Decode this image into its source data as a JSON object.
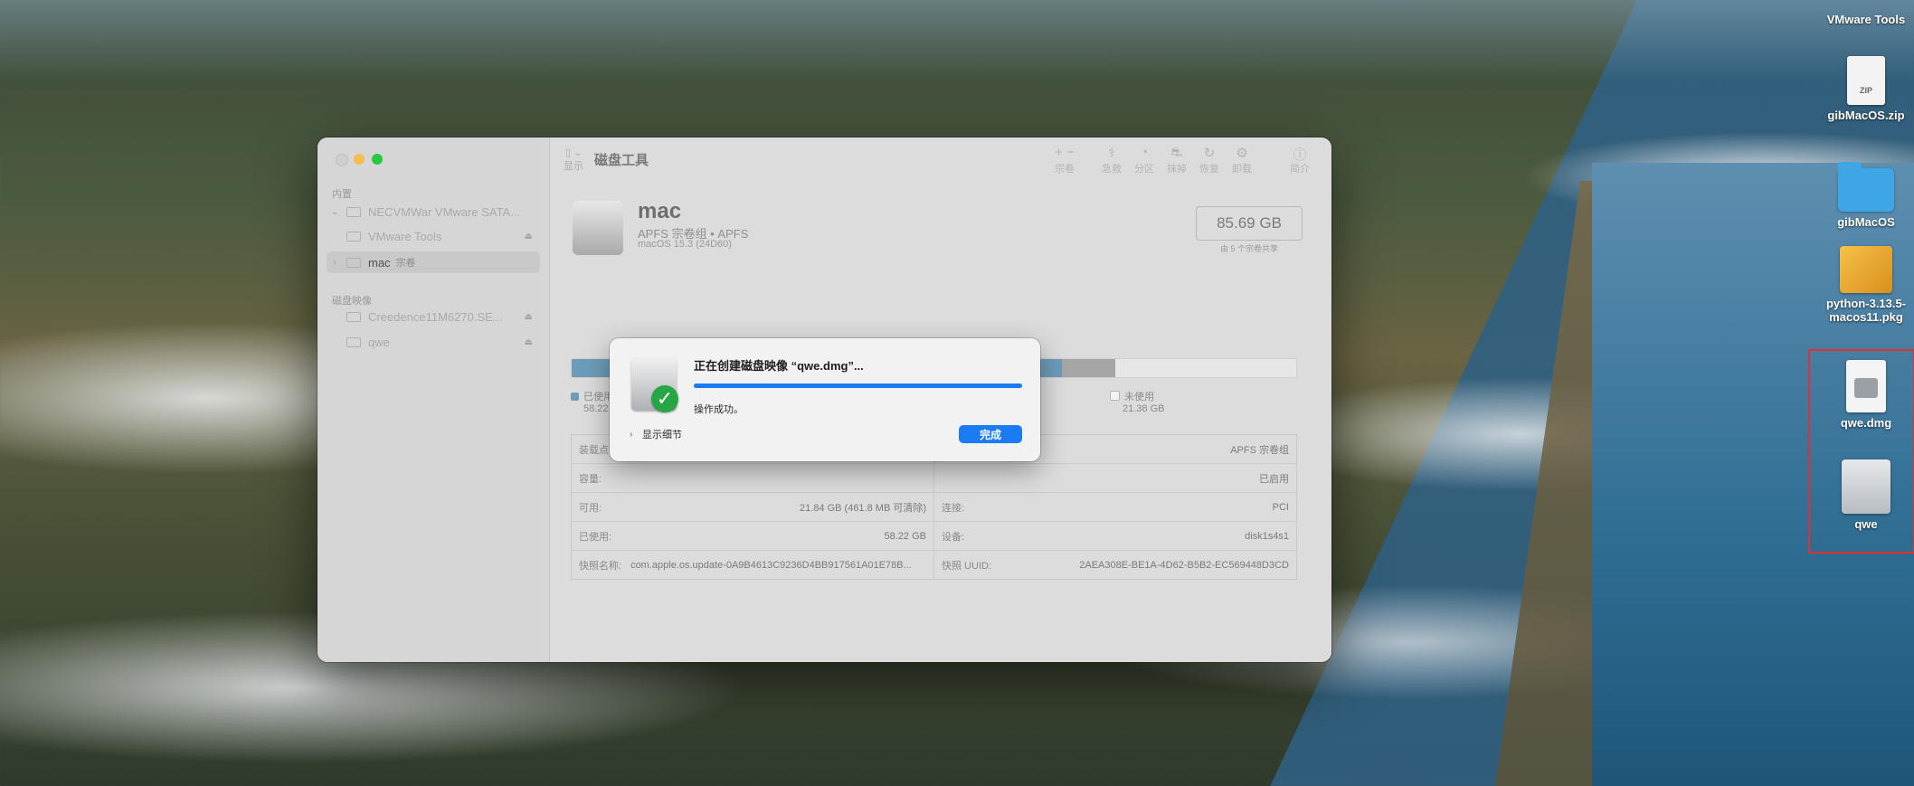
{
  "desktop": {
    "icons": [
      {
        "label": "VMware Tools"
      },
      {
        "label": "gibMacOS.zip",
        "badge": "ZIP"
      },
      {
        "label": "gibMacOS"
      },
      {
        "label": "python-3.13.5-macos11.pkg"
      },
      {
        "label": "qwe.dmg"
      },
      {
        "label": "qwe"
      }
    ]
  },
  "window": {
    "toolbar": {
      "title": "磁盘工具",
      "view_label": "显示",
      "buttons": [
        "宗卷",
        "急救",
        "分区",
        "抹掉",
        "恢复",
        "卸载",
        "简介"
      ],
      "add_remove": "+ −"
    },
    "sidebar": {
      "internal_header": "内置",
      "internal_items": [
        {
          "label": "NECVMWar VMware SATA..."
        },
        {
          "label": "VMware Tools"
        },
        {
          "label": "mac",
          "sub": "宗卷"
        }
      ],
      "images_header": "磁盘映像",
      "image_items": [
        {
          "label": "Creedence11M6270.SE..."
        },
        {
          "label": "qwe"
        }
      ]
    },
    "volume": {
      "name": "mac",
      "subtitle": "APFS 宗卷组 • APFS",
      "os": "macOS 15.3 (24D60)",
      "capacity": "85.69 GB",
      "capacity_note": "由 5 个宗卷共享"
    },
    "usage": {
      "used_fraction": 0.677,
      "other_fraction": 0.073,
      "used_label": "已使用",
      "used_value": "58.22 GB",
      "free_label": "未使用",
      "free_value": "21.38 GB"
    },
    "info": {
      "rows": [
        [
          {
            "label": "装载点:",
            "value": ""
          },
          {
            "label": "",
            "value": "APFS 宗卷组"
          }
        ],
        [
          {
            "label": "容量:",
            "value": ""
          },
          {
            "label": "",
            "value": "已启用"
          }
        ],
        [
          {
            "label": "可用:",
            "value": "21.84 GB (461.8 MB 可清除)"
          },
          {
            "label": "连接:",
            "value": "PCI"
          }
        ],
        [
          {
            "label": "已使用:",
            "value": "58.22 GB"
          },
          {
            "label": "设备:",
            "value": "disk1s4s1"
          }
        ],
        [
          {
            "label": "快照名称:",
            "value": "com.apple.os.update-0A9B4613C9236D4BB917561A01E78B..."
          },
          {
            "label": "快照 UUID:",
            "value": "2AEA308E-BE1A-4D62-B5B2-EC569448D3CD"
          }
        ]
      ]
    }
  },
  "dialog": {
    "title": "正在创建磁盘映像 “qwe.dmg”...",
    "progress": 1.0,
    "status": "操作成功。",
    "details_label": "显示细节",
    "done_label": "完成"
  },
  "colors": {
    "accent": "#1a7bf2",
    "success": "#27a644",
    "used_bar": "#6d9cb9",
    "selection": "#e23030"
  }
}
